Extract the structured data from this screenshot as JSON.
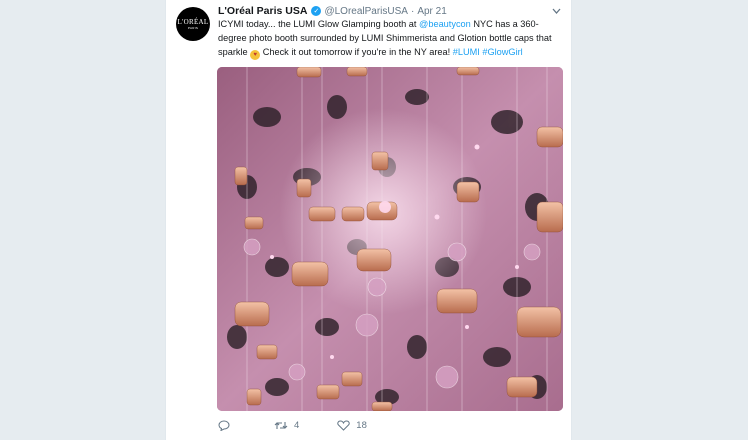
{
  "tweet": {
    "avatar_text": "L'ORÉAL",
    "avatar_sub": "PARIS",
    "display_name": "L'Oréal Paris USA",
    "handle": "@LOrealParisUSA",
    "separator": "·",
    "date": "Apr 21",
    "text": {
      "part1": "ICYMI today... the LUMI Glow Glamping booth at ",
      "mention": "@beautycon",
      "part2": " NYC has a 360-degree photo booth surrounded by LUMI Shimmerista and Glotion bottle caps that sparkle ",
      "part3": " Check it out tomorrow if you're in the NY area! ",
      "hashtag1": "#LUMI",
      "hashtag2": "#GlowGirl"
    },
    "emoji": "heart-eyes-emoji",
    "actions": {
      "reply_count": "",
      "retweet_count": "4",
      "like_count": "18"
    }
  },
  "colors": {
    "background": "#e6ecf0",
    "link": "#1da1f2",
    "verified": "#1da1f2",
    "text": "#14171a",
    "muted": "#657786"
  }
}
